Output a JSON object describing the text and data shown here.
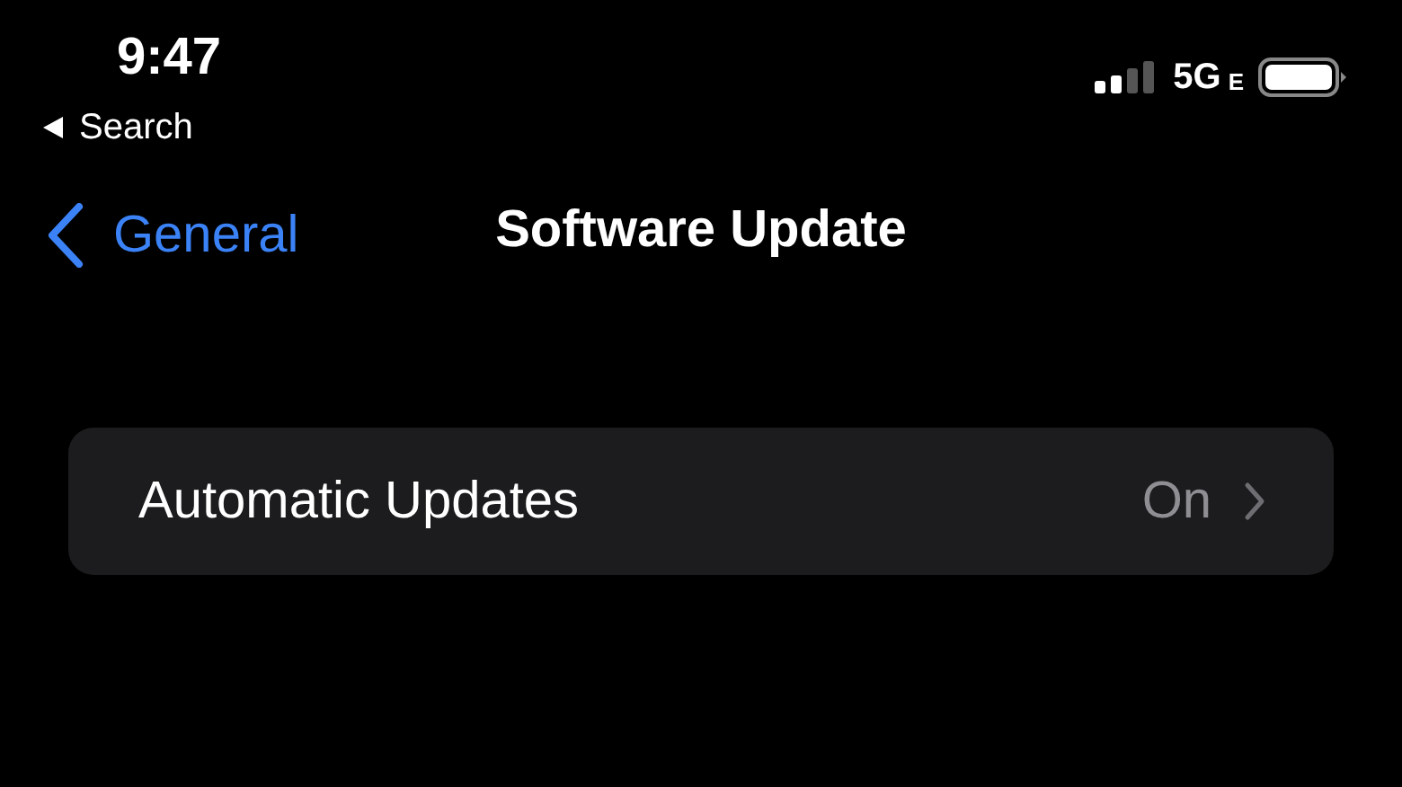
{
  "status_bar": {
    "time": "9:47",
    "back_app": "Search",
    "network": "5G",
    "network_sub": "E"
  },
  "nav": {
    "back_label": "General",
    "title": "Software Update"
  },
  "settings": [
    {
      "label": "Automatic Updates",
      "value": "On"
    }
  ]
}
